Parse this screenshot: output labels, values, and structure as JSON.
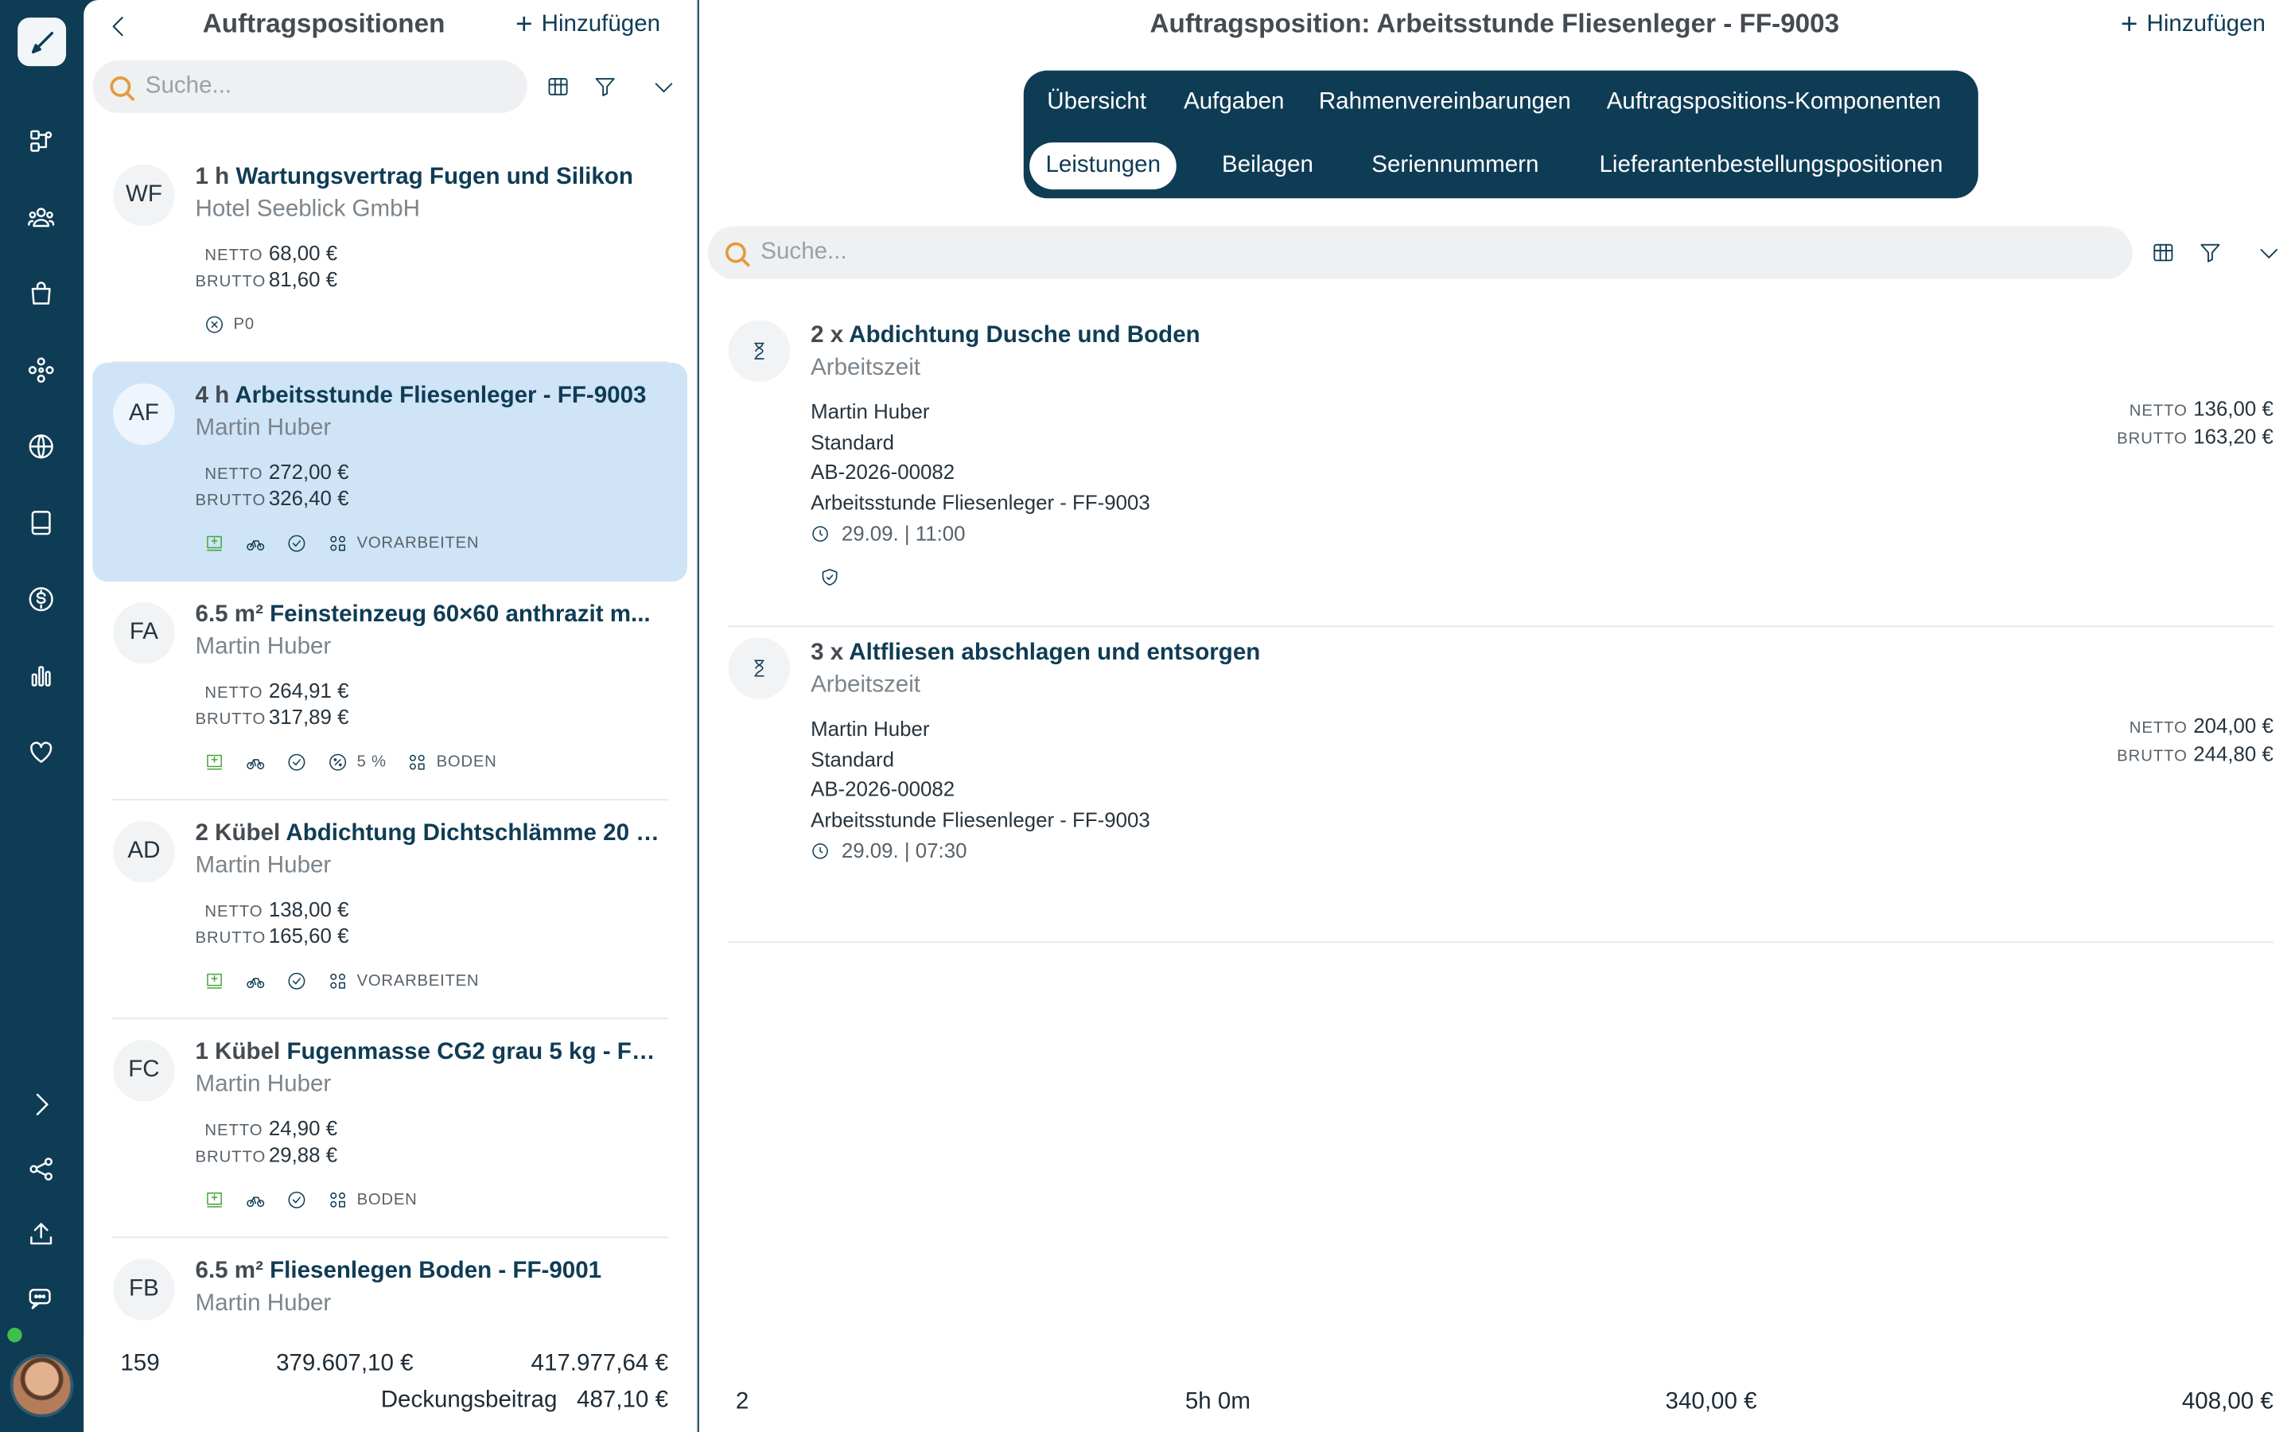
{
  "left_panel": {
    "title": "Auftragspositionen",
    "add_label": "Hinzufügen",
    "search_placeholder": "Suche...",
    "items": [
      {
        "initials": "WF",
        "qty": "1 h",
        "name": "Wartungsvertrag Fugen und Silikon",
        "sub": "Hotel Seeblick GmbH",
        "netto": "68,00 €",
        "brutto": "81,60 €",
        "tag": "P0",
        "selected": false
      },
      {
        "initials": "AF",
        "qty": "4 h",
        "name": "Arbeitsstunde Fliesenleger - FF-9003",
        "sub": "Martin Huber",
        "netto": "272,00 €",
        "brutto": "326,40 €",
        "tag": "VORARBEITEN",
        "selected": true
      },
      {
        "initials": "FA",
        "qty": "6.5 m²",
        "name": "Feinsteinzeug 60×60 anthrazit m...",
        "sub": "Martin Huber",
        "netto": "264,91 €",
        "brutto": "317,89 €",
        "discount": "5 %",
        "tag": "BODEN",
        "selected": false
      },
      {
        "initials": "AD",
        "qty": "2 Kübel",
        "name": "Abdichtung Dichtschlämme 20 k...",
        "sub": "Martin Huber",
        "netto": "138,00 €",
        "brutto": "165,60 €",
        "tag": "VORARBEITEN",
        "selected": false
      },
      {
        "initials": "FC",
        "qty": "1 Kübel",
        "name": "Fugenmasse CG2 grau 5 kg - FF-...",
        "sub": "Martin Huber",
        "netto": "24,90 €",
        "brutto": "29,88 €",
        "tag": "BODEN",
        "selected": false
      },
      {
        "initials": "FB",
        "qty": "6.5 m²",
        "name": "Fliesenlegen Boden - FF-9001",
        "sub": "Martin Huber"
      }
    ],
    "footer": {
      "count": "159",
      "netto_total": "379.607,10 €",
      "brutto_total": "417.977,64 €",
      "margin_label": "Deckungsbeitrag",
      "margin_value": "487,10 €"
    }
  },
  "labels": {
    "netto": "NETTO",
    "brutto": "BRUTTO"
  },
  "right_panel": {
    "title": "Auftragsposition: Arbeitsstunde Fliesenleger - FF-9003",
    "add_label": "Hinzufügen",
    "tabs_row1": [
      "Übersicht",
      "Aufgaben",
      "Rahmenvereinbarungen",
      "Auftragspositions-Komponenten"
    ],
    "tabs_row2": [
      "Leistungen",
      "Beilagen",
      "Seriennummern",
      "Lieferantenbestellungspositionen"
    ],
    "active_tab": "Leistungen",
    "search_placeholder": "Suche...",
    "services": [
      {
        "qty": "2 x",
        "name": "Abdichtung Dusche und Boden",
        "type": "Arbeitszeit",
        "person": "Martin Huber",
        "rate": "Standard",
        "doc": "AB-2026-00082",
        "position": "Arbeitsstunde Fliesenleger - FF-9003",
        "date": "29.09. | 11:00",
        "netto": "136,00 €",
        "brutto": "163,20 €"
      },
      {
        "qty": "3 x",
        "name": "Altfliesen abschlagen und entsorgen",
        "type": "Arbeitszeit",
        "person": "Martin Huber",
        "rate": "Standard",
        "doc": "AB-2026-00082",
        "position": "Arbeitsstunde Fliesenleger - FF-9003",
        "date": "29.09. | 07:30",
        "netto": "204,00 €",
        "brutto": "244,80 €"
      }
    ],
    "footer": {
      "count": "2",
      "duration": "5h 0m",
      "netto_total": "340,00 €",
      "brutto_total": "408,00 €"
    }
  },
  "icons": {
    "rail": [
      "pen-icon",
      "workflow-icon",
      "contacts-icon",
      "bag-icon",
      "modules-icon",
      "globe-icon",
      "book-icon",
      "dollar-icon",
      "chart-icon",
      "heart-icon",
      "chevron-right-icon",
      "share-icon",
      "upload-icon",
      "chat-icon"
    ]
  },
  "colors": {
    "brand": "#0f3c55",
    "selected": "#cfe4f7",
    "online": "#3fbf4b",
    "search_accent": "#e39b3b",
    "green": "#44a63b"
  }
}
